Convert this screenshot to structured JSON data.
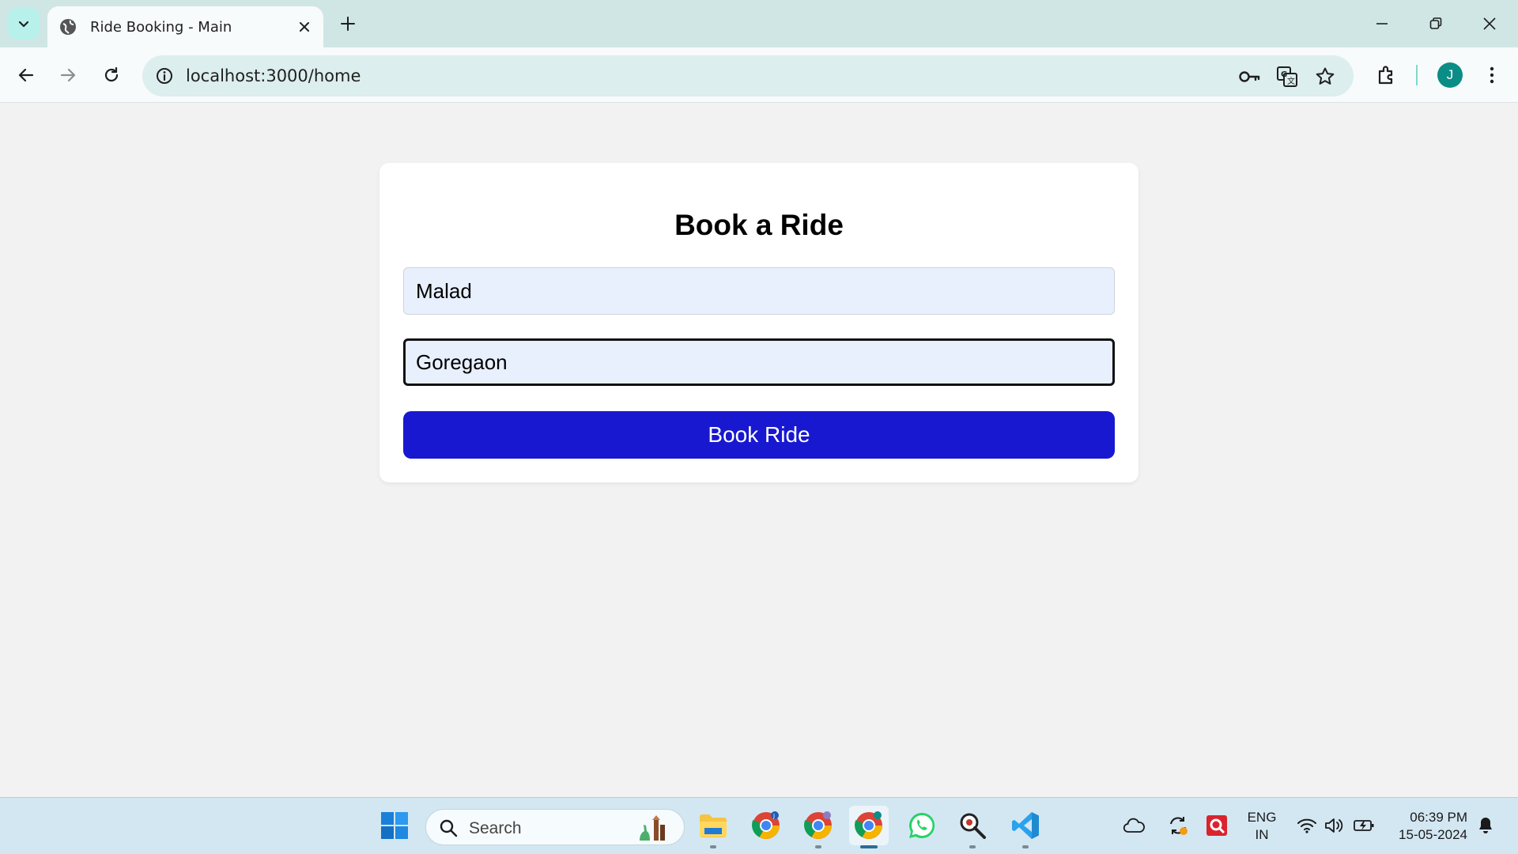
{
  "browser": {
    "tab_title": "Ride Booking - Main",
    "url": "localhost:3000/home",
    "profile_initial": "J"
  },
  "page": {
    "heading": "Book a Ride",
    "pickup_value": "Malad",
    "destination_value": "Goregaon",
    "book_button_label": "Book Ride"
  },
  "taskbar": {
    "search_label": "Search",
    "language_line1": "ENG",
    "language_line2": "IN",
    "time": "06:39 PM",
    "date": "15-05-2024"
  },
  "colors": {
    "book_button": "#1818d0",
    "input_bg": "#e8effd",
    "tabstrip_bg": "#cfe6e4",
    "avatar_bg": "#0b8d87"
  }
}
